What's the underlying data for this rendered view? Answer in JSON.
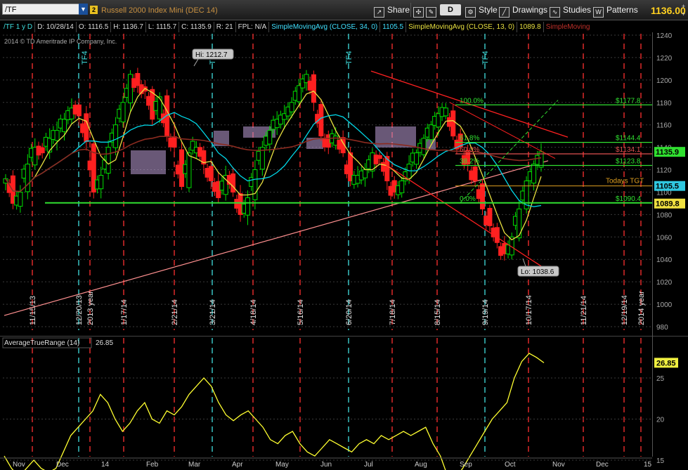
{
  "toolbar": {
    "symbol": "/TF",
    "link_number": "2",
    "instrument_name": "Russell 2000 Index Mini (DEC 14)",
    "share_label": "Share",
    "d_label": "D",
    "style_label": "Style",
    "drawings_label": "Drawings",
    "studies_label": "Studies",
    "patterns_label": "Patterns",
    "last_price": "1136.00",
    "plus_sign": "+"
  },
  "info_bar": {
    "symbol_period": "/TF 1 y D",
    "date": "D: 10/28/14",
    "open": "O: 1116.5",
    "high": "H: 1136.7",
    "low": "L: 1115.7",
    "close": "C: 1135.9",
    "range": "R: 21",
    "fpl": "FPL: N/A",
    "sma34_label": "SimpleMovingAvg (CLOSE, 34, 0)",
    "sma34_value": "1105.5",
    "sma13_label": "SimpleMovingAvg (CLOSE, 13, 0)",
    "sma13_value": "1089.8",
    "sma_extra_label": "SimpleMoving"
  },
  "copyright": "2014 © TD Ameritrade IP Company, Inc.",
  "colors": {
    "background": "#000000",
    "up_candle": "#00e000",
    "down_candle": "#ff2020",
    "sma34": "#00d8e8",
    "sma13": "#e8e040",
    "sma200": "#8b2b20",
    "long_trend": "#ff9090",
    "fib_line": "#30e030",
    "target_line": "#e0a020",
    "trend_channel": "#ff2020",
    "event_line": "#ff3030",
    "options_line": "#40e0e0",
    "atr_line": "#ffff30"
  },
  "annotations": {
    "hi_label": "Hi: 1212.7",
    "lo_label": "Lo: 1038.6",
    "fib_100": "100.0%",
    "fib_618": "61.8%",
    "fib_50": "50.0%",
    "fib_382": "38.2%",
    "fib_0": "0.0%",
    "price_1177": "$1177.8",
    "price_1144": "$1144.4",
    "price_1134": "$1134.1",
    "price_1123": "$1123.8",
    "price_1090": "$1090.4",
    "todays_tgt": "Todays TGT"
  },
  "price_badges": {
    "current": "1135.9",
    "sma34": "1105.5",
    "sma13": "1089.8"
  },
  "price_axis": [
    "1240",
    "1220",
    "1200",
    "1180",
    "1160",
    "1140",
    "1120",
    "1100",
    "1080",
    "1060",
    "1040",
    "1020",
    "1000",
    "980"
  ],
  "event_dates": [
    {
      "label": "11/15/13",
      "kind": "expiry"
    },
    {
      "label": "12/20/13",
      "kind": "options"
    },
    {
      "label": "2013 year",
      "kind": "expiry"
    },
    {
      "label": "1/17/14",
      "kind": "expiry"
    },
    {
      "label": "2/21/14",
      "kind": "expiry"
    },
    {
      "label": "3/21/14",
      "kind": "options"
    },
    {
      "label": "4/18/14",
      "kind": "expiry"
    },
    {
      "label": "5/16/14",
      "kind": "expiry"
    },
    {
      "label": "6/20/14",
      "kind": "options"
    },
    {
      "label": "7/18/14",
      "kind": "expiry"
    },
    {
      "label": "8/15/14",
      "kind": "expiry"
    },
    {
      "label": "9/19/14",
      "kind": "options"
    },
    {
      "label": "10/17/14",
      "kind": "expiry"
    },
    {
      "label": "11/21/14",
      "kind": "expiry"
    },
    {
      "label": "12/19/14",
      "kind": "expiry"
    },
    {
      "label": "2014 year",
      "kind": "expiry"
    }
  ],
  "top_markers": [
    "TF4",
    "TF4",
    "TF4",
    "TF4",
    "TF4"
  ],
  "atr_panel": {
    "title": "AverageTrueRange (14)",
    "value": "26.85",
    "axis": [
      "25",
      "20",
      "15"
    ]
  },
  "x_axis_months": [
    "Nov",
    "Dec",
    "14",
    "Feb",
    "Mar",
    "Apr",
    "May",
    "Jun",
    "Jul",
    "Aug",
    "Sep",
    "Oct",
    "Nov",
    "Dec",
    "15"
  ],
  "chart_data": {
    "type": "line",
    "title": "Russell 2000 Index Mini (DEC 14)",
    "price_range": [
      980,
      1240
    ],
    "atr_range": [
      12,
      30
    ],
    "key_points": [
      {
        "label": "Hi",
        "value": 1212.7
      },
      {
        "label": "Lo",
        "value": 1038.6
      }
    ],
    "levels": [
      {
        "name": "100.0%",
        "price": 1177.8
      },
      {
        "name": "61.8%",
        "price": 1144.4
      },
      {
        "name": "50.0%",
        "price": 1134.1
      },
      {
        "name": "38.2%",
        "price": 1123.8
      },
      {
        "name": "0.0%",
        "price": 1090.4
      }
    ],
    "series": [
      {
        "name": "/TF close",
        "values": [
          1112,
          1090,
          1100,
          1125,
          1140,
          1135,
          1148,
          1155,
          1165,
          1175,
          1168,
          1145,
          1100,
          1115,
          1140,
          1160,
          1180,
          1205,
          1195,
          1190,
          1165,
          1185,
          1150,
          1140,
          1105,
          1135,
          1140,
          1125,
          1110,
          1095,
          1115,
          1100,
          1080,
          1095,
          1120,
          1140,
          1155,
          1165,
          1170,
          1180,
          1195,
          1205,
          1180,
          1150,
          1140,
          1150,
          1135,
          1110,
          1115,
          1120,
          1135,
          1130,
          1110,
          1100,
          1110,
          1125,
          1135,
          1148,
          1160,
          1170,
          1175,
          1150,
          1140,
          1125,
          1110,
          1085,
          1070,
          1055,
          1045,
          1060,
          1085,
          1110,
          1125,
          1136
        ]
      },
      {
        "name": "ATR (14)",
        "values": [
          15.5,
          14,
          13,
          14,
          15,
          14,
          13.5,
          14,
          16,
          18,
          19,
          20,
          21,
          23,
          22,
          20,
          18.5,
          19.5,
          21,
          22,
          20,
          19.5,
          21,
          20.5,
          21.5,
          23,
          24,
          25,
          24,
          22,
          20.5,
          19.8,
          20.5,
          21,
          20,
          19,
          17.5,
          17,
          18,
          18.5,
          17,
          16,
          15.5,
          16.5,
          17.5,
          17,
          16.5,
          16,
          17,
          17.5,
          17,
          18,
          17.5,
          18,
          18.5,
          18,
          18.5,
          19,
          17,
          15.5,
          13,
          12.8,
          14,
          15.5,
          17,
          18.5,
          20,
          21,
          22,
          25,
          27,
          28,
          27.5,
          26.85
        ]
      }
    ]
  }
}
